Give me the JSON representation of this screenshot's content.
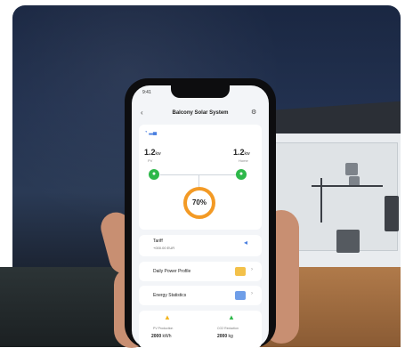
{
  "app": {
    "title": "Balcony Solar System",
    "status_time": "9:41",
    "back_icon": "chevron-left-icon",
    "settings_icon": "gear-icon"
  },
  "energy": {
    "left_power": "1.2",
    "left_unit": "kw",
    "left_sub": "PV",
    "right_power": "1.2",
    "right_unit": "kw",
    "right_sub": "Home",
    "battery_percent": "70%"
  },
  "rows": [
    {
      "label": "Tariff",
      "sub": "+000.00 EUR",
      "icon": "share-icon"
    },
    {
      "label": "Daily Power Profile",
      "icon": "bar-chart-icon"
    },
    {
      "label": "Energy Statistics",
      "icon": "line-chart-icon"
    }
  ],
  "bottom": {
    "left_label": "PV Production",
    "left_value": "2000",
    "left_unit": "kWh",
    "right_label": "CO2 Reduction",
    "right_value": "2000",
    "right_unit": "kg"
  },
  "colors": {
    "accent_orange": "#f39a25",
    "accent_green": "#2eb84a",
    "accent_blue": "#4a7fe0"
  }
}
